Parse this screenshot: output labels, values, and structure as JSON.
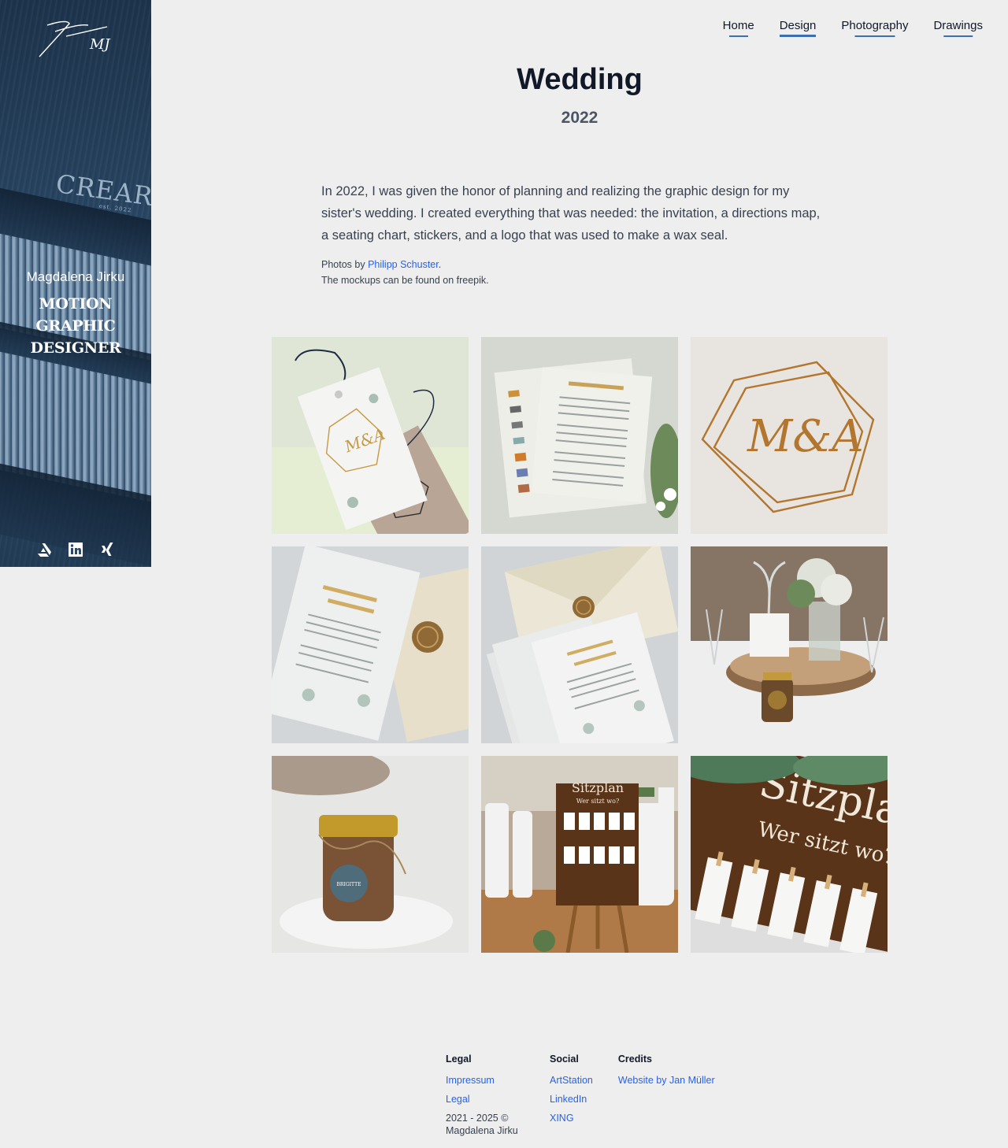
{
  "sidebar": {
    "logo_icon": "signature-logo-icon",
    "logo_initials": "MJ",
    "background_word": "CREARTI",
    "background_subword": "est. 2022",
    "name": "Magdalena Jirku",
    "role": "MOTION GRAPHIC DESIGNER",
    "social": [
      {
        "icon": "artstation-icon"
      },
      {
        "icon": "linkedin-icon"
      },
      {
        "icon": "xing-icon"
      }
    ]
  },
  "nav": {
    "items": [
      {
        "label": "Home"
      },
      {
        "label": "Design"
      },
      {
        "label": "Photography"
      },
      {
        "label": "Drawings"
      }
    ],
    "active": "Design",
    "accent": "#3b6fb0"
  },
  "page": {
    "title": "Wedding",
    "year": "2022",
    "intro": "In 2022, I was given the honor of planning and realizing the graphic design for my sister's wedding. I created everything that was needed: the invitation, a directions map, a seating chart, stickers, and a logo that was used to make a wax seal.",
    "photos_prefix": "Photos by ",
    "photographer": "Philipp Schuster",
    "photos_suffix": ".",
    "mockups_note": "The mockups can be found on freepik."
  },
  "gallery": {
    "images": [
      {
        "label": "tag-mockup"
      },
      {
        "label": "menu-card"
      },
      {
        "label": "monogram-logo"
      },
      {
        "label": "invitation-wax-seal"
      },
      {
        "label": "envelope-stack"
      },
      {
        "label": "table-centerpiece"
      },
      {
        "label": "jar-sticker"
      },
      {
        "label": "seating-chart-easel"
      },
      {
        "label": "seating-chart-closeup"
      }
    ],
    "monogram_text": "M&A",
    "sign_title": "Sitzplan",
    "sign_subtitle": "Wer sitzt wo?",
    "sticker_text": "BRIGITTE"
  },
  "footer": {
    "legal": {
      "heading": "Legal",
      "links": [
        "Impressum",
        "Legal"
      ],
      "copyright": "2021 - 2025 © Magdalena Jirku"
    },
    "social": {
      "heading": "Social",
      "links": [
        "ArtStation",
        "LinkedIn",
        "XING"
      ]
    },
    "credits": {
      "heading": "Credits",
      "links": [
        "Website by Jan Müller"
      ]
    },
    "link_color": "#2563eb"
  }
}
